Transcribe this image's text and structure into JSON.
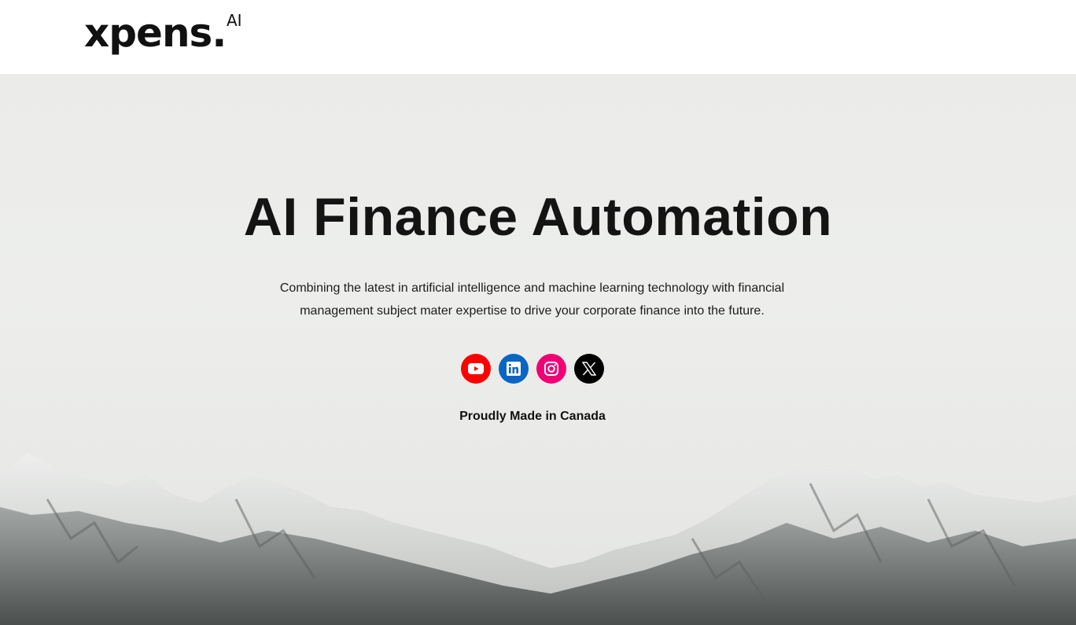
{
  "brand": {
    "name": "xpens",
    "superscript": "AI",
    "dot": "."
  },
  "hero": {
    "title": "AI Finance Automation",
    "description": "Combining the latest in artificial intelligence and machine learning technology with financial management subject mater expertise to drive your corporate finance into the future.",
    "tagline": "Proudly Made in Canada"
  },
  "socials": [
    {
      "name": "YouTube",
      "icon": "youtube-icon",
      "color": "#ff0000"
    },
    {
      "name": "LinkedIn",
      "icon": "linkedin-icon",
      "color": "#0a66c2"
    },
    {
      "name": "Instagram",
      "icon": "instagram-icon",
      "color": "#f00075"
    },
    {
      "name": "X",
      "icon": "x-icon",
      "color": "#000000"
    }
  ],
  "colors": {
    "text": "#141414",
    "background": "#ffffff",
    "hero_sky": "#ecedeb"
  }
}
